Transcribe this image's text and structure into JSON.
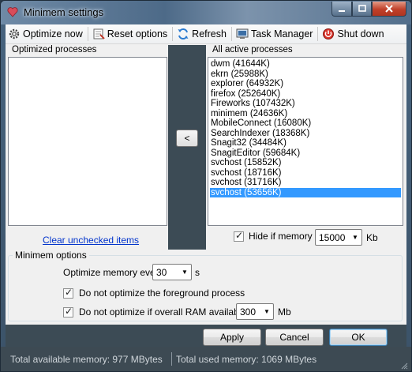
{
  "window": {
    "title": "Minimem settings"
  },
  "toolbar": {
    "items": [
      {
        "label": "Optimize now",
        "icon": "gear-icon"
      },
      {
        "label": "Reset options",
        "icon": "reset-icon"
      },
      {
        "label": "Refresh",
        "icon": "refresh-icon"
      },
      {
        "label": "Task Manager",
        "icon": "task-manager-icon"
      },
      {
        "label": "Shut down",
        "icon": "shutdown-icon"
      }
    ]
  },
  "optimized": {
    "title": "Optimized processes",
    "clear_link": "Clear unchecked items"
  },
  "move_button": {
    "label": "<"
  },
  "active": {
    "title": "All active processes",
    "processes": [
      "dwm (41644K)",
      "ekrn (25988K)",
      "explorer (64932K)",
      "firefox (252640K)",
      "Fireworks (107432K)",
      "minimem (24636K)",
      "MobileConnect (16080K)",
      "SearchIndexer (18368K)",
      "Snagit32 (34484K)",
      "SnagitEditor (59684K)",
      "svchost (15852K)",
      "svchost (18716K)",
      "svchost (31716K)",
      "svchost (53656K)"
    ],
    "selected_index": 13,
    "hide_label": "Hide if memory <",
    "hide_value": "15000",
    "hide_unit": "Kb",
    "hide_checked": true
  },
  "options": {
    "title": "Minimem options",
    "optimize_every_label": "Optimize memory every",
    "optimize_every_value": "30",
    "optimize_every_unit": "s",
    "foreground_label": "Do not optimize the foreground process",
    "foreground_checked": true,
    "ram_label": "Do not optimize if overall RAM available >",
    "ram_value": "300",
    "ram_unit": "Mb",
    "ram_checked": true
  },
  "buttons": {
    "apply": "Apply",
    "cancel": "Cancel",
    "ok": "OK"
  },
  "status": {
    "available": "Total available memory: 977 MBytes",
    "used": "Total used memory: 1069 MBytes"
  },
  "colors": {
    "selection": "#3399ff",
    "link": "#0033cc",
    "strip": "#3c4b55"
  }
}
